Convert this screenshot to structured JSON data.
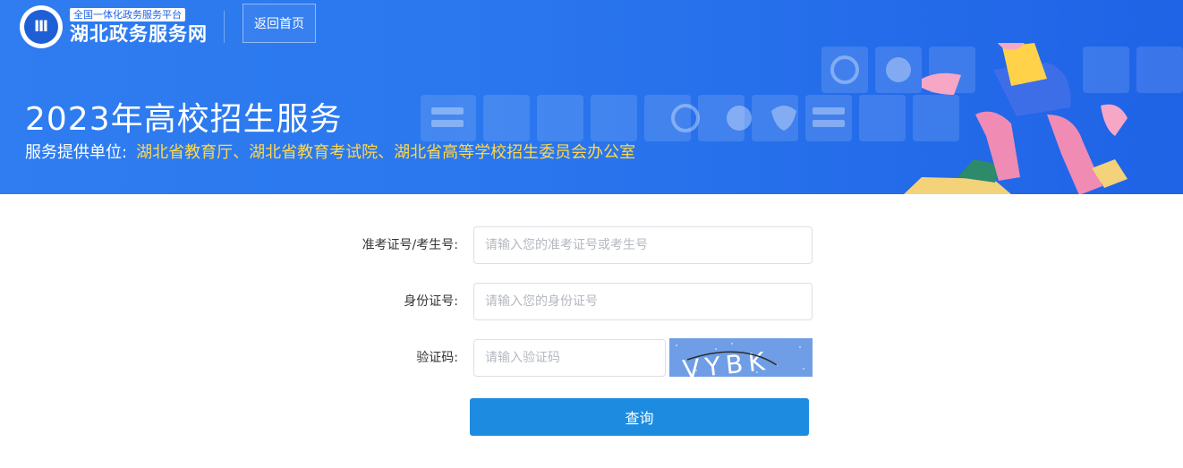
{
  "header": {
    "platform_tag": "全国一体化政务服务平台",
    "site_name": "湖北政务服务网",
    "home_button": "返回首页",
    "title": "2023年高校招生服务",
    "provider_label": "服务提供单位:",
    "provider_value": "湖北省教育厅、湖北省教育考试院、湖北省高等学校招生委员会办公室"
  },
  "form": {
    "exam_id_label": "准考证号/考生号:",
    "exam_id_placeholder": "请输入您的准考证号或考生号",
    "id_card_label": "身份证号:",
    "id_card_placeholder": "请输入您的身份证号",
    "captcha_label": "验证码:",
    "captcha_placeholder": "请输入验证码",
    "captcha_text": "VYBK",
    "submit_label": "查询"
  },
  "colors": {
    "banner_blue": "#2a76ee",
    "provider_yellow": "#ffd84a",
    "button_blue": "#1d8ce0"
  }
}
